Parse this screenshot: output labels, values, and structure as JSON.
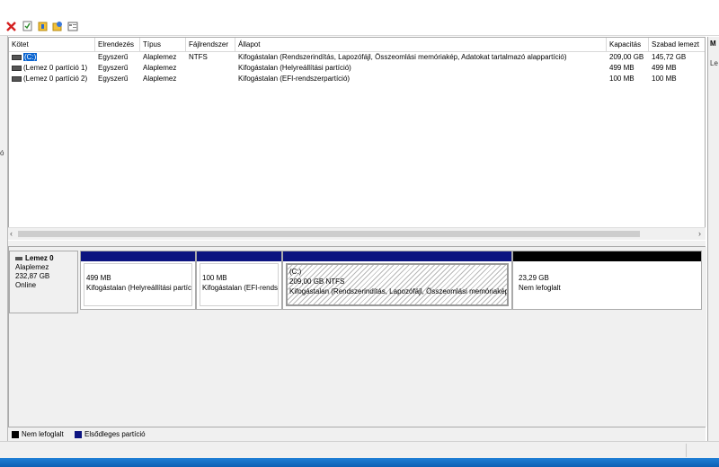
{
  "toolbar": {
    "icons": [
      "delete-icon",
      "properties-icon",
      "help-icon",
      "wizard-icon",
      "view-icon"
    ]
  },
  "colors": {
    "unallocated": "#000000",
    "primary_partition": "#0c1480",
    "selection": "#0a64d0"
  },
  "left_fragment": "ó",
  "volume_list": {
    "columns": [
      "Kötet",
      "Elrendezés",
      "Típus",
      "Fájlrendszer",
      "Állapot",
      "Kapacitás",
      "Szabad lemezt"
    ],
    "rows": [
      {
        "volume": "(C:)",
        "layout": "Egyszerű",
        "type": "Alaplemez",
        "fs": "NTFS",
        "status": "Kifogástalan (Rendszerindítás, Lapozófájl, Összeomlási memóriakép, Adatokat tartalmazó alappartíció)",
        "capacity": "209,00 GB",
        "free": "145,72 GB"
      },
      {
        "volume": "(Lemez 0 partíció 1)",
        "layout": "Egyszerű",
        "type": "Alaplemez",
        "fs": "",
        "status": "Kifogástalan (Helyreállítási partíció)",
        "capacity": "499 MB",
        "free": "499 MB"
      },
      {
        "volume": "(Lemez 0 partíció 2)",
        "layout": "Egyszerű",
        "type": "Alaplemez",
        "fs": "",
        "status": "Kifogástalan (EFI-rendszerpartíció)",
        "capacity": "100 MB",
        "free": "100 MB"
      }
    ]
  },
  "disk": {
    "name": "Lemez 0",
    "type": "Alaplemez",
    "size": "232,87 GB",
    "state": "Online",
    "partitions": [
      {
        "title": "",
        "size": "499 MB",
        "status": "Kifogástalan (Helyreállítási partíció)"
      },
      {
        "title": "",
        "size": "100 MB",
        "status": "Kifogástalan (EFI-rendszerpartíció)"
      },
      {
        "title": "(C:)",
        "size": "209,00 GB NTFS",
        "status": "Kifogástalan (Rendszerindítás, Lapozófájl, Összeomlási memóriakép, Adatokat tartalmazó alappartíció)"
      },
      {
        "title": "",
        "size": "23,29 GB",
        "status": "Nem lefoglalt"
      }
    ]
  },
  "legend": {
    "unallocated": "Nem lefoglalt",
    "primary": "Elsődleges partíció"
  },
  "right_pane": {
    "header": "M",
    "item": "Le"
  }
}
